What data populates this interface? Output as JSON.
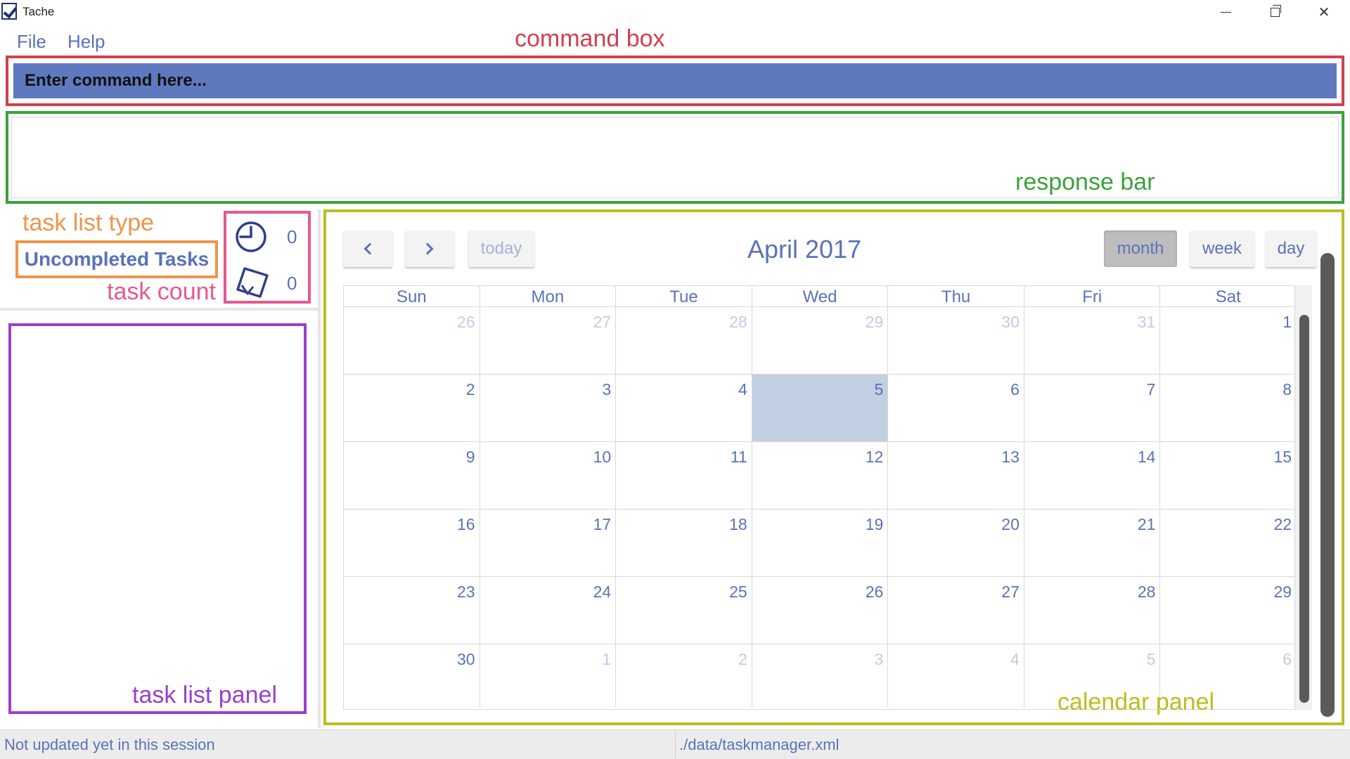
{
  "window": {
    "title": "Tache",
    "icon": "app-check-icon",
    "controls": [
      "minimize-icon",
      "maximize-icon",
      "close-icon"
    ]
  },
  "menu": {
    "file": "File",
    "help": "Help"
  },
  "annotations": {
    "command_box": "command box",
    "response_bar": "response bar",
    "task_list_type": "task list type",
    "task_count": "task count",
    "task_list_panel": "task list panel",
    "calendar_panel": "calendar panel"
  },
  "command": {
    "placeholder": "Enter command here..."
  },
  "response": {
    "text": ""
  },
  "task_list": {
    "type": "Uncompleted Tasks",
    "timed_count": "0",
    "floating_count": "0"
  },
  "calendar": {
    "title": "April 2017",
    "today_label": "today",
    "views": {
      "month": "month",
      "week": "week",
      "day": "day"
    },
    "active_view": "month",
    "weekdays": [
      "Sun",
      "Mon",
      "Tue",
      "Wed",
      "Thu",
      "Fri",
      "Sat"
    ],
    "weeks": [
      [
        {
          "d": "26",
          "o": true
        },
        {
          "d": "27",
          "o": true
        },
        {
          "d": "28",
          "o": true
        },
        {
          "d": "29",
          "o": true
        },
        {
          "d": "30",
          "o": true
        },
        {
          "d": "31",
          "o": true
        },
        {
          "d": "1",
          "o": false
        }
      ],
      [
        {
          "d": "2",
          "o": false
        },
        {
          "d": "3",
          "o": false
        },
        {
          "d": "4",
          "o": false
        },
        {
          "d": "5",
          "o": false,
          "today": true
        },
        {
          "d": "6",
          "o": false
        },
        {
          "d": "7",
          "o": false
        },
        {
          "d": "8",
          "o": false
        }
      ],
      [
        {
          "d": "9",
          "o": false
        },
        {
          "d": "10",
          "o": false
        },
        {
          "d": "11",
          "o": false
        },
        {
          "d": "12",
          "o": false
        },
        {
          "d": "13",
          "o": false
        },
        {
          "d": "14",
          "o": false
        },
        {
          "d": "15",
          "o": false
        }
      ],
      [
        {
          "d": "16",
          "o": false
        },
        {
          "d": "17",
          "o": false
        },
        {
          "d": "18",
          "o": false
        },
        {
          "d": "19",
          "o": false
        },
        {
          "d": "20",
          "o": false
        },
        {
          "d": "21",
          "o": false
        },
        {
          "d": "22",
          "o": false
        }
      ],
      [
        {
          "d": "23",
          "o": false
        },
        {
          "d": "24",
          "o": false
        },
        {
          "d": "25",
          "o": false
        },
        {
          "d": "26",
          "o": false
        },
        {
          "d": "27",
          "o": false
        },
        {
          "d": "28",
          "o": false
        },
        {
          "d": "29",
          "o": false
        }
      ],
      [
        {
          "d": "30",
          "o": false
        },
        {
          "d": "1",
          "o": true
        },
        {
          "d": "2",
          "o": true
        },
        {
          "d": "3",
          "o": true
        },
        {
          "d": "4",
          "o": true
        },
        {
          "d": "5",
          "o": true
        },
        {
          "d": "6",
          "o": true
        }
      ]
    ]
  },
  "status": {
    "sync": "Not updated yet in this session",
    "file_path": "./data/taskmanager.xml"
  },
  "colors": {
    "accent": "#5b72b8",
    "command_bg": "#5f79bf",
    "today_bg": "#c3cfe2",
    "annotation_command": "#d0414f",
    "annotation_response": "#3ca13c",
    "annotation_list_type": "#f0944a",
    "annotation_task_count": "#e8588d",
    "annotation_list_panel": "#9a3fcc",
    "annotation_calendar": "#b8c020"
  }
}
